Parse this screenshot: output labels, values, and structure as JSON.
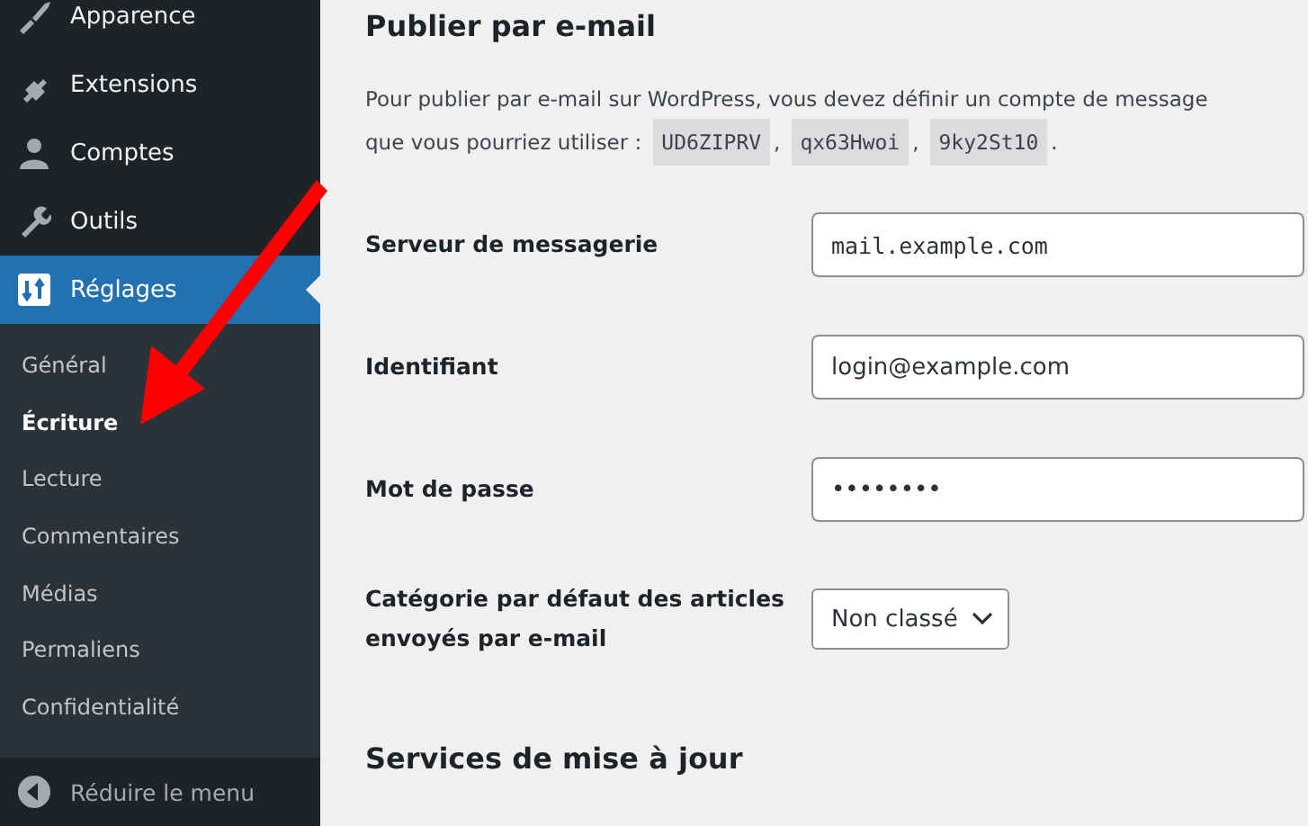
{
  "sidebar": {
    "items": [
      {
        "label": "Apparence",
        "selected": false
      },
      {
        "label": "Extensions",
        "selected": false
      },
      {
        "label": "Comptes",
        "selected": false
      },
      {
        "label": "Outils",
        "selected": false
      },
      {
        "label": "Réglages",
        "selected": true
      }
    ],
    "submenu": [
      {
        "label": "Général",
        "selected": false
      },
      {
        "label": "Écriture",
        "selected": true
      },
      {
        "label": "Lecture",
        "selected": false
      },
      {
        "label": "Commentaires",
        "selected": false
      },
      {
        "label": "Médias",
        "selected": false
      },
      {
        "label": "Permaliens",
        "selected": false
      },
      {
        "label": "Confidentialité",
        "selected": false
      }
    ],
    "collapse": "Réduire le menu"
  },
  "section": {
    "title": "Publier par e-mail",
    "intro": "Pour publier par e-mail sur WordPress, vous devez définir un compte de message",
    "intro_line2": "que vous pourriez utiliser :",
    "codes": [
      {
        "code": "UD6ZIPRV",
        "after": ","
      },
      {
        "code": "qx63Hwoi",
        "after": ","
      },
      {
        "code": "9ky2St10",
        "after": "."
      }
    ],
    "fields": [
      {
        "kind": "text",
        "label": "Serveur de messagerie",
        "value": "mail.example.com",
        "mono": true
      },
      {
        "kind": "text",
        "label": "Identifiant",
        "value": "login@example.com",
        "mono": false
      },
      {
        "kind": "text",
        "label": "Mot de passe",
        "value": "••••••••",
        "mono": false
      },
      {
        "kind": "select",
        "label": "Catégorie par défaut des articles envoyés par e-mail",
        "value": "Non classé"
      }
    ]
  },
  "section2": {
    "title": "Services de mise à jour"
  }
}
